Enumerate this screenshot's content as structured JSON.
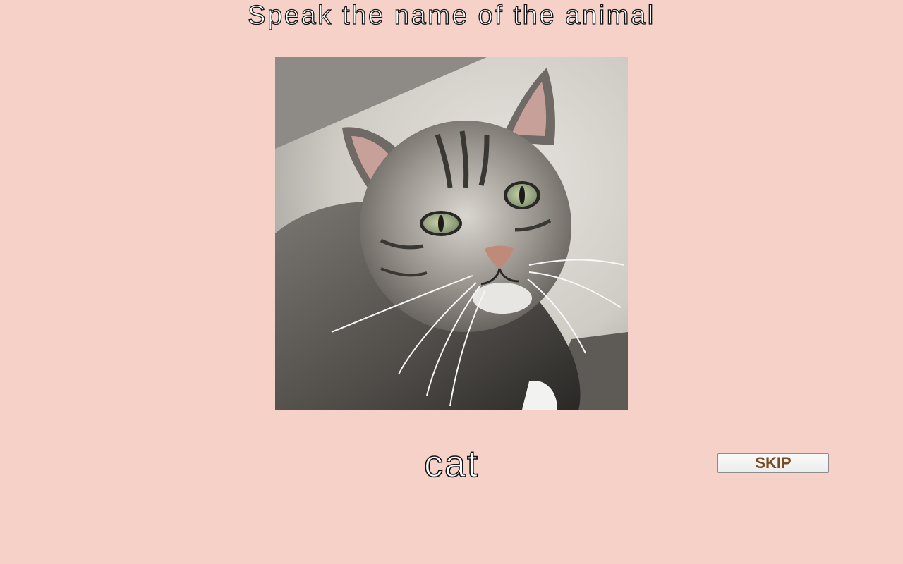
{
  "game": {
    "instruction": "Speak the name of the animal",
    "image_subject": "cat",
    "answer": "cat",
    "skip_label": "SKIP"
  },
  "colors": {
    "background": "#f5d1c8",
    "text_fill": "#ffffff",
    "text_outline": "#111111",
    "skip_text": "#7a4b22"
  }
}
